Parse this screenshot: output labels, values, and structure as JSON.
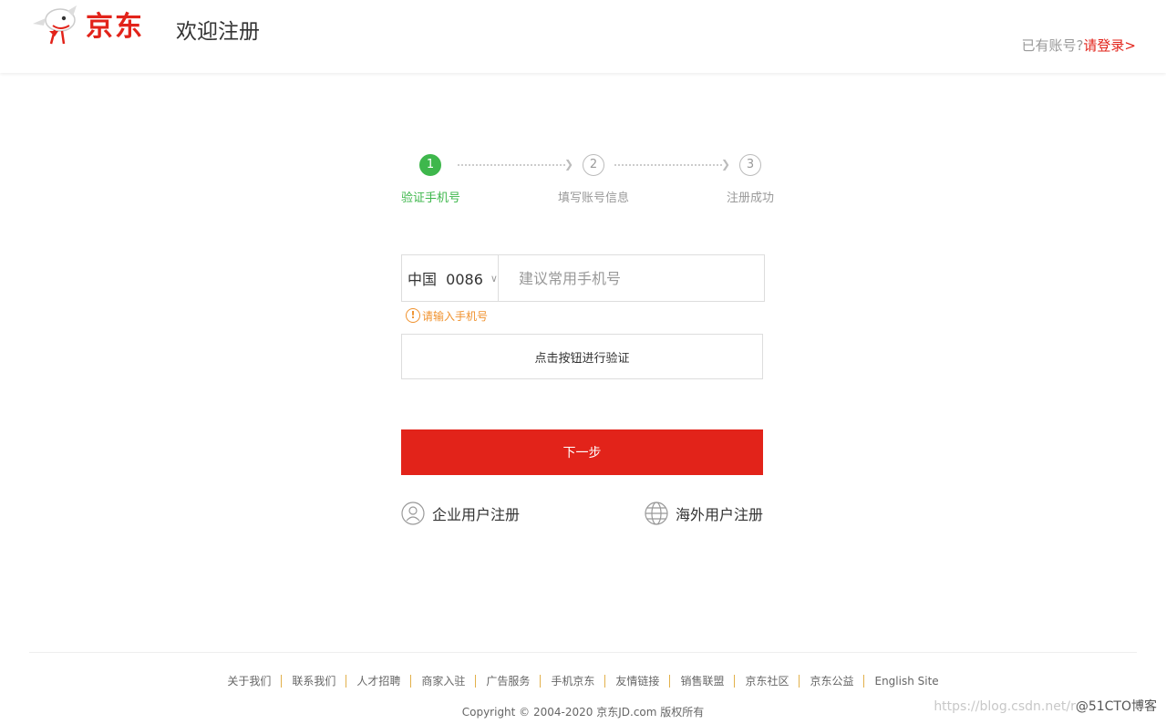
{
  "header": {
    "logo_text": "京东",
    "welcome": "欢迎注册",
    "login_prompt": "已有账号?",
    "login_link": "请登录>"
  },
  "steps": [
    {
      "number": "1",
      "label": "验证手机号",
      "active": true
    },
    {
      "number": "2",
      "label": "填写账号信息",
      "active": false
    },
    {
      "number": "3",
      "label": "注册成功",
      "active": false
    }
  ],
  "form": {
    "country_code": "中国  0086",
    "phone_placeholder": "建议常用手机号",
    "phone_value": "",
    "error_icon": "!",
    "error_text": "请输入手机号",
    "verify_label": "点击按钮进行验证",
    "next_label": "下一步"
  },
  "alt_links": {
    "enterprise": "企业用户注册",
    "overseas": "海外用户注册"
  },
  "footer": {
    "links": [
      "关于我们",
      "联系我们",
      "人才招聘",
      "商家入驻",
      "广告服务",
      "手机京东",
      "友情链接",
      "销售联盟",
      "京东社区",
      "京东公益",
      "English Site"
    ],
    "copyright": "Copyright © 2004-2020 京东JD.com 版权所有"
  },
  "watermark": {
    "url": "https://blog.csdn.net/r",
    "brand": "@51CTO博客"
  },
  "colors": {
    "brand_red": "#e2231a",
    "step_green": "#3eb74c",
    "warning_orange": "#f0922e"
  }
}
